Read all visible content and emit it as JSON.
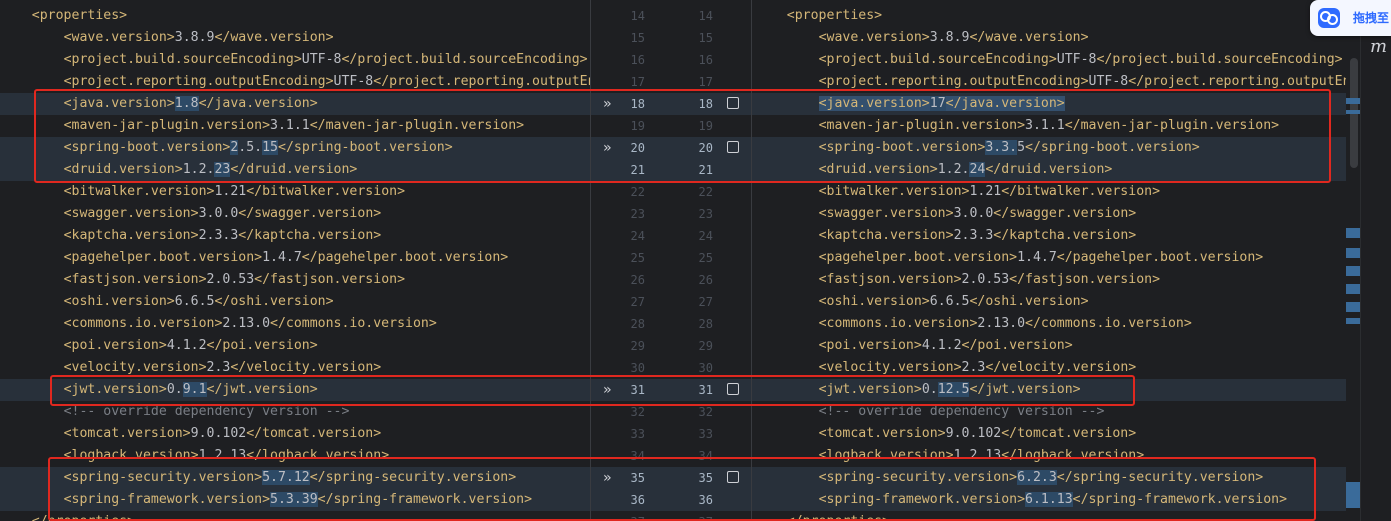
{
  "left_lines": [
    {
      "n": 14,
      "indent": 4,
      "tag_open": "<properties>",
      "value": "",
      "tag_close": "",
      "kind": "tag"
    },
    {
      "n": 15,
      "indent": 8,
      "tag_open": "<wave.version>",
      "value": "3.8.9",
      "tag_close": "</wave.version>",
      "kind": "prop"
    },
    {
      "n": 16,
      "indent": 8,
      "tag_open": "<project.build.sourceEncoding>",
      "value": "UTF-8",
      "tag_close": "</project.build.sourceEncoding>",
      "kind": "prop"
    },
    {
      "n": 17,
      "indent": 8,
      "tag_open": "<project.reporting.outputEncoding>",
      "value": "UTF-8",
      "tag_close": "</project.reporting.outputEncoding>",
      "kind": "prop"
    },
    {
      "n": 18,
      "indent": 8,
      "tag_open": "<java.version>",
      "value": "1.8",
      "tag_close": "</java.version>",
      "kind": "prop",
      "changed": true,
      "hl": [
        "",
        "1.8",
        ""
      ]
    },
    {
      "n": 19,
      "indent": 8,
      "tag_open": "<maven-jar-plugin.version>",
      "value": "3.1.1",
      "tag_close": "</maven-jar-plugin.version>",
      "kind": "prop"
    },
    {
      "n": 20,
      "indent": 8,
      "tag_open": "<spring-boot.version>",
      "value": "2.5.15",
      "tag_close": "</spring-boot.version>",
      "kind": "prop",
      "changed": true,
      "hl": [
        "",
        "2",
        ".5.",
        "15",
        ""
      ]
    },
    {
      "n": 21,
      "indent": 8,
      "tag_open": "<druid.version>",
      "value": "1.2.23",
      "tag_close": "</druid.version>",
      "kind": "prop",
      "changed": true,
      "hl": [
        "1.2.",
        "23",
        ""
      ]
    },
    {
      "n": 22,
      "indent": 8,
      "tag_open": "<bitwalker.version>",
      "value": "1.21",
      "tag_close": "</bitwalker.version>",
      "kind": "prop"
    },
    {
      "n": 23,
      "indent": 8,
      "tag_open": "<swagger.version>",
      "value": "3.0.0",
      "tag_close": "</swagger.version>",
      "kind": "prop"
    },
    {
      "n": 24,
      "indent": 8,
      "tag_open": "<kaptcha.version>",
      "value": "2.3.3",
      "tag_close": "</kaptcha.version>",
      "kind": "prop"
    },
    {
      "n": 25,
      "indent": 8,
      "tag_open": "<pagehelper.boot.version>",
      "value": "1.4.7",
      "tag_close": "</pagehelper.boot.version>",
      "kind": "prop"
    },
    {
      "n": 26,
      "indent": 8,
      "tag_open": "<fastjson.version>",
      "value": "2.0.53",
      "tag_close": "</fastjson.version>",
      "kind": "prop"
    },
    {
      "n": 27,
      "indent": 8,
      "tag_open": "<oshi.version>",
      "value": "6.6.5",
      "tag_close": "</oshi.version>",
      "kind": "prop"
    },
    {
      "n": 28,
      "indent": 8,
      "tag_open": "<commons.io.version>",
      "value": "2.13.0",
      "tag_close": "</commons.io.version>",
      "kind": "prop"
    },
    {
      "n": 29,
      "indent": 8,
      "tag_open": "<poi.version>",
      "value": "4.1.2",
      "tag_close": "</poi.version>",
      "kind": "prop"
    },
    {
      "n": 30,
      "indent": 8,
      "tag_open": "<velocity.version>",
      "value": "2.3",
      "tag_close": "</velocity.version>",
      "kind": "prop"
    },
    {
      "n": 31,
      "indent": 8,
      "tag_open": "<jwt.version>",
      "value": "0.9.1",
      "tag_close": "</jwt.version>",
      "kind": "prop",
      "changed": true,
      "hl": [
        "0.",
        "9.1",
        ""
      ]
    },
    {
      "n": 32,
      "indent": 8,
      "tag_open": "",
      "value": "<!-- override dependency version -->",
      "tag_close": "",
      "kind": "comment"
    },
    {
      "n": 33,
      "indent": 8,
      "tag_open": "<tomcat.version>",
      "value": "9.0.102",
      "tag_close": "</tomcat.version>",
      "kind": "prop"
    },
    {
      "n": 34,
      "indent": 8,
      "tag_open": "<logback.version>",
      "value": "1.2.13",
      "tag_close": "</logback.version>",
      "kind": "prop"
    },
    {
      "n": 35,
      "indent": 8,
      "tag_open": "<spring-security.version>",
      "value": "5.7.12",
      "tag_close": "</spring-security.version>",
      "kind": "prop",
      "changed": true,
      "hl": [
        "",
        "5.7.12",
        ""
      ]
    },
    {
      "n": 36,
      "indent": 8,
      "tag_open": "<spring-framework.version>",
      "value": "5.3.39",
      "tag_close": "</spring-framework.version>",
      "kind": "prop",
      "changed": true,
      "hl": [
        "",
        "5.3.39",
        ""
      ]
    },
    {
      "n": 37,
      "indent": 4,
      "tag_open": "</properties>",
      "value": "",
      "tag_close": "",
      "kind": "tag"
    }
  ],
  "right_lines": [
    {
      "n": 14,
      "indent": 4,
      "tag_open": "<properties>",
      "value": "",
      "tag_close": "",
      "kind": "tag"
    },
    {
      "n": 15,
      "indent": 8,
      "tag_open": "<wave.version>",
      "value": "3.8.9",
      "tag_close": "</wave.version>",
      "kind": "prop"
    },
    {
      "n": 16,
      "indent": 8,
      "tag_open": "<project.build.sourceEncoding>",
      "value": "UTF-8",
      "tag_close": "</project.build.sourceEncoding>",
      "kind": "prop"
    },
    {
      "n": 17,
      "indent": 8,
      "tag_open": "<project.reporting.outputEncoding>",
      "value": "UTF-8",
      "tag_close": "</project.reporting.outputEncoding>",
      "kind": "prop"
    },
    {
      "n": 18,
      "indent": 8,
      "tag_open": "<java.version>",
      "value": "17",
      "tag_close": "</java.version>",
      "kind": "prop",
      "changed": true,
      "hl": [
        "",
        "17",
        ""
      ],
      "hl_tags": true
    },
    {
      "n": 19,
      "indent": 8,
      "tag_open": "<maven-jar-plugin.version>",
      "value": "3.1.1",
      "tag_close": "</maven-jar-plugin.version>",
      "kind": "prop"
    },
    {
      "n": 20,
      "indent": 8,
      "tag_open": "<spring-boot.version>",
      "value": "3.3.5",
      "tag_close": "</spring-boot.version>",
      "kind": "prop",
      "changed": true,
      "hl": [
        "",
        "3.3.",
        "5",
        ""
      ]
    },
    {
      "n": 21,
      "indent": 8,
      "tag_open": "<druid.version>",
      "value": "1.2.24",
      "tag_close": "</druid.version>",
      "kind": "prop",
      "changed": true,
      "hl": [
        "1.2.",
        "24",
        ""
      ]
    },
    {
      "n": 22,
      "indent": 8,
      "tag_open": "<bitwalker.version>",
      "value": "1.21",
      "tag_close": "</bitwalker.version>",
      "kind": "prop"
    },
    {
      "n": 23,
      "indent": 8,
      "tag_open": "<swagger.version>",
      "value": "3.0.0",
      "tag_close": "</swagger.version>",
      "kind": "prop"
    },
    {
      "n": 24,
      "indent": 8,
      "tag_open": "<kaptcha.version>",
      "value": "2.3.3",
      "tag_close": "</kaptcha.version>",
      "kind": "prop"
    },
    {
      "n": 25,
      "indent": 8,
      "tag_open": "<pagehelper.boot.version>",
      "value": "1.4.7",
      "tag_close": "</pagehelper.boot.version>",
      "kind": "prop"
    },
    {
      "n": 26,
      "indent": 8,
      "tag_open": "<fastjson.version>",
      "value": "2.0.53",
      "tag_close": "</fastjson.version>",
      "kind": "prop"
    },
    {
      "n": 27,
      "indent": 8,
      "tag_open": "<oshi.version>",
      "value": "6.6.5",
      "tag_close": "</oshi.version>",
      "kind": "prop"
    },
    {
      "n": 28,
      "indent": 8,
      "tag_open": "<commons.io.version>",
      "value": "2.13.0",
      "tag_close": "</commons.io.version>",
      "kind": "prop"
    },
    {
      "n": 29,
      "indent": 8,
      "tag_open": "<poi.version>",
      "value": "4.1.2",
      "tag_close": "</poi.version>",
      "kind": "prop"
    },
    {
      "n": 30,
      "indent": 8,
      "tag_open": "<velocity.version>",
      "value": "2.3",
      "tag_close": "</velocity.version>",
      "kind": "prop"
    },
    {
      "n": 31,
      "indent": 8,
      "tag_open": "<jwt.version>",
      "value": "0.12.5",
      "tag_close": "</jwt.version>",
      "kind": "prop",
      "changed": true,
      "hl": [
        "0.",
        "12.5",
        ""
      ]
    },
    {
      "n": 32,
      "indent": 8,
      "tag_open": "",
      "value": "<!-- override dependency version -->",
      "tag_close": "",
      "kind": "comment"
    },
    {
      "n": 33,
      "indent": 8,
      "tag_open": "<tomcat.version>",
      "value": "9.0.102",
      "tag_close": "</tomcat.version>",
      "kind": "prop"
    },
    {
      "n": 34,
      "indent": 8,
      "tag_open": "<logback.version>",
      "value": "1.2.13",
      "tag_close": "</logback.version>",
      "kind": "prop"
    },
    {
      "n": 35,
      "indent": 8,
      "tag_open": "<spring-security.version>",
      "value": "6.2.3",
      "tag_close": "</spring-security.version>",
      "kind": "prop",
      "changed": true,
      "hl": [
        "",
        "6.2.3",
        ""
      ]
    },
    {
      "n": 36,
      "indent": 8,
      "tag_open": "<spring-framework.version>",
      "value": "6.1.13",
      "tag_close": "</spring-framework.version>",
      "kind": "prop",
      "changed": true,
      "hl": [
        "",
        "6.1.13",
        ""
      ]
    },
    {
      "n": 37,
      "indent": 4,
      "tag_open": "</properties>",
      "value": "",
      "tag_close": "",
      "kind": "tag"
    }
  ],
  "gutter_arrow": "»",
  "baidu_widget": {
    "label": "拖拽至",
    "icon": "baidu-netdisk-icon"
  },
  "side_strip_letter": "m",
  "colors": {
    "tag": "#d5b778",
    "changed_bg": "#28303a",
    "highlight": "#2d4a66",
    "annotation": "#e0281f"
  }
}
